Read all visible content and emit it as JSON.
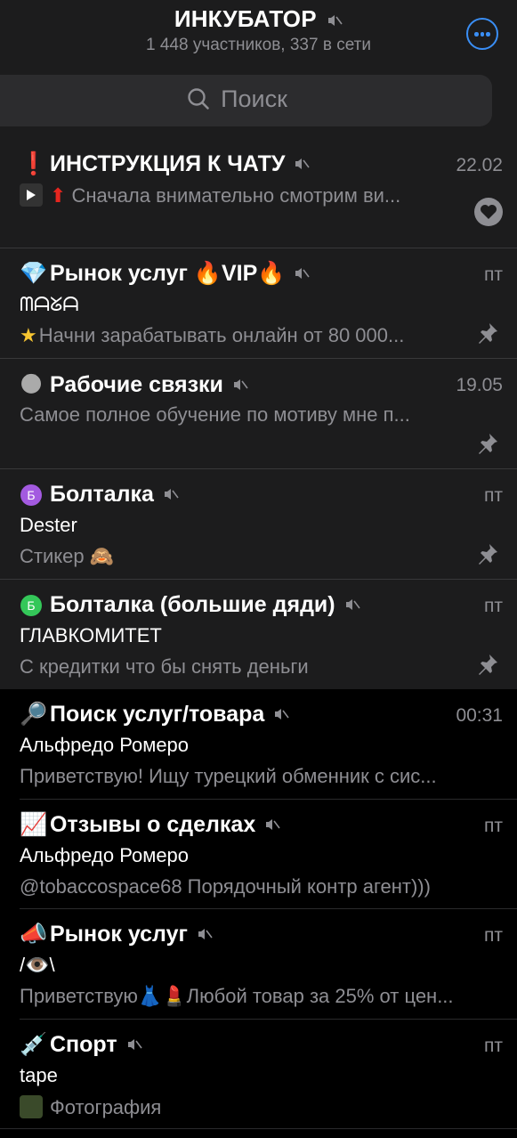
{
  "header": {
    "title": "ИНКУБАТОР",
    "subtitle": "1 448 участников, 337 в сети"
  },
  "search": {
    "placeholder": "Поиск"
  },
  "chats": [
    {
      "emoji": "❗",
      "name": "ИНСТРУКЦИЯ К ЧАТУ",
      "time": "22.02",
      "sender": "",
      "preview": "Сначала внимательно смотрим ви...",
      "pinned": true,
      "reaction": "heart"
    },
    {
      "emoji": "💎",
      "name": "Рынок услуг 🔥VIP🔥",
      "time": "пт",
      "sender": "ᗰᗩᘜᗩ",
      "preview": "Начни зарабатывать онлайн от 80 000...",
      "pinned": true
    },
    {
      "emoji": "🌑",
      "name": "Рабочие связки",
      "time": "19.05",
      "sender": "",
      "preview": "Самое полное обучение по мотиву мне п...",
      "pinned": true
    },
    {
      "emoji": "Б",
      "name": "Болталка",
      "time": "пт",
      "sender": "Dester",
      "preview": "Стикер 🙈",
      "pinned": true
    },
    {
      "emoji": "Б",
      "name": "Болталка (большие дяди)",
      "time": "пт",
      "sender": "ГЛАВКОМИТЕТ",
      "preview": "С кредитки что бы снять деньги",
      "pinned": true
    },
    {
      "emoji": "🔎",
      "name": "Поиск услуг/товара",
      "time": "00:31",
      "sender": "Альфредо Ромеро",
      "preview": "Приветствую! Ищу турецкий обменник с сис...",
      "pinned": false
    },
    {
      "emoji": "📈",
      "name": "Отзывы о сделках",
      "time": "пт",
      "sender": "Альфредо Ромеро",
      "preview": "@tobaccospace68 Порядочный контр агент)))",
      "pinned": false
    },
    {
      "emoji": "📣",
      "name": "Рынок услуг",
      "time": "пт",
      "sender": "/👁️\\",
      "preview": "Приветствую👗💄Любой товар за 25% от цен...",
      "pinned": false
    },
    {
      "emoji": "💉",
      "name": "Спорт",
      "time": "пт",
      "sender": "tape",
      "preview": "Фотография",
      "pinned": false
    }
  ],
  "colors": {
    "accent": "#3a8ef5",
    "pinned_bg": "#1c1c1d",
    "secondary_text": "#8e8e93"
  }
}
